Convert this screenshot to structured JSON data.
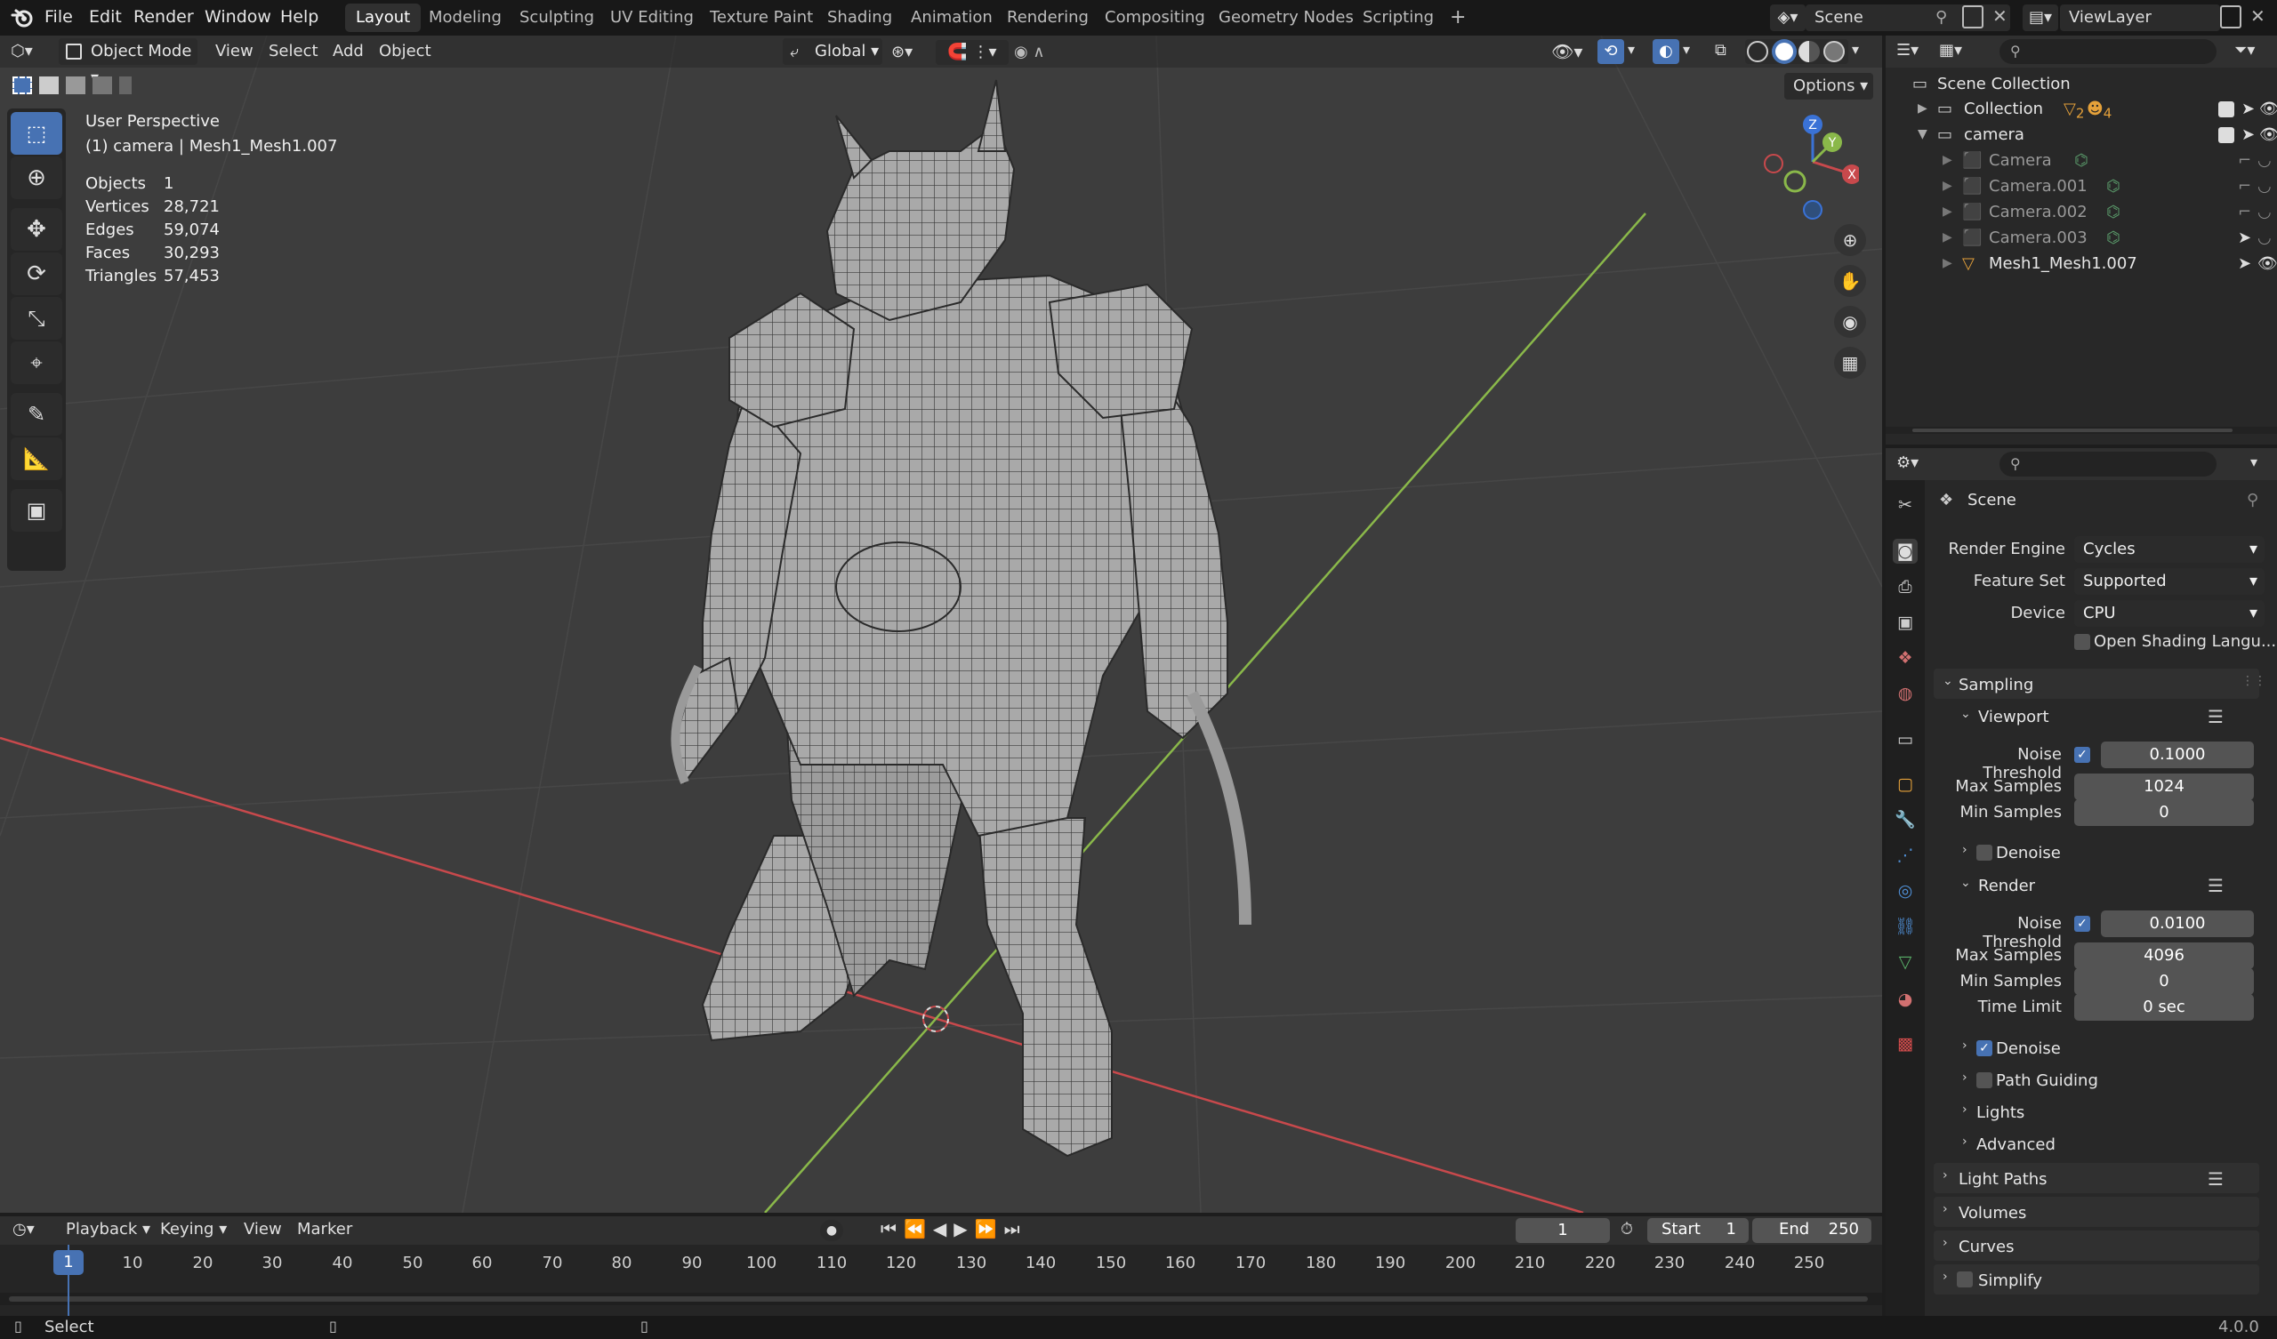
{
  "app": {
    "logo": "blender-logo-icon"
  },
  "menu": [
    "File",
    "Edit",
    "Render",
    "Window",
    "Help"
  ],
  "workspaces": [
    "Layout",
    "Modeling",
    "Sculpting",
    "UV Editing",
    "Texture Paint",
    "Shading",
    "Animation",
    "Rendering",
    "Compositing",
    "Geometry Nodes",
    "Scripting"
  ],
  "active_workspace": "Layout",
  "scene": {
    "name": "Scene",
    "view_layer": "ViewLayer"
  },
  "viewport": {
    "mode": "Object Mode",
    "menus": [
      "View",
      "Select",
      "Add",
      "Object"
    ],
    "transform_orientation": "Global",
    "options_label": "Options",
    "perspective": "User Perspective",
    "active_info": "(1) camera | Mesh1_Mesh1.007",
    "stats": [
      {
        "label": "Objects",
        "value": "1"
      },
      {
        "label": "Vertices",
        "value": "28,721"
      },
      {
        "label": "Edges",
        "value": "59,074"
      },
      {
        "label": "Faces",
        "value": "30,293"
      },
      {
        "label": "Triangles",
        "value": "57,453"
      }
    ],
    "gizmo": {
      "x": "X",
      "y": "Y",
      "z": "Z"
    },
    "colors": {
      "bg": "#3d3d3d",
      "x_axis": "#c8494c",
      "y_axis": "#8ab84a",
      "selection": "#4772b3"
    }
  },
  "outliner": {
    "root": "Scene Collection",
    "rows": [
      {
        "name": "Collection",
        "level": 1,
        "type": "collection",
        "badge1": "2",
        "badge2": "4"
      },
      {
        "name": "camera",
        "level": 1,
        "type": "collection",
        "expanded": true
      },
      {
        "name": "Camera",
        "level": 2,
        "type": "camera"
      },
      {
        "name": "Camera.001",
        "level": 2,
        "type": "camera"
      },
      {
        "name": "Camera.002",
        "level": 2,
        "type": "camera"
      },
      {
        "name": "Camera.003",
        "level": 2,
        "type": "camera"
      },
      {
        "name": "Mesh1_Mesh1.007",
        "level": 2,
        "type": "mesh"
      }
    ]
  },
  "properties": {
    "context": "Scene",
    "render_engine_label": "Render Engine",
    "render_engine": "Cycles",
    "feature_set_label": "Feature Set",
    "feature_set": "Supported",
    "device_label": "Device",
    "device": "CPU",
    "osl_label": "Open Shading Langu...",
    "sampling": {
      "title": "Sampling",
      "viewport": {
        "title": "Viewport",
        "noise_label": "Noise Threshold",
        "noise": "0.1000",
        "max_label": "Max Samples",
        "max": "1024",
        "min_label": "Min Samples",
        "min": "0",
        "denoise_label": "Denoise"
      },
      "render": {
        "title": "Render",
        "noise_label": "Noise Threshold",
        "noise": "0.0100",
        "max_label": "Max Samples",
        "max": "4096",
        "min_label": "Min Samples",
        "min": "0",
        "time_label": "Time Limit",
        "time": "0 sec",
        "denoise_label": "Denoise",
        "path_guiding_label": "Path Guiding",
        "lights_label": "Lights",
        "advanced_label": "Advanced"
      }
    },
    "panels": [
      "Light Paths",
      "Volumes",
      "Curves",
      "Simplify"
    ]
  },
  "timeline": {
    "menus": [
      "Playback",
      "Keying",
      "View",
      "Marker"
    ],
    "current_frame": "1",
    "start_label": "Start",
    "start": "1",
    "end_label": "End",
    "end": "250",
    "ticks": [
      "1",
      "10",
      "20",
      "30",
      "40",
      "50",
      "60",
      "70",
      "80",
      "90",
      "100",
      "110",
      "120",
      "130",
      "140",
      "150",
      "160",
      "170",
      "180",
      "190",
      "200",
      "210",
      "220",
      "230",
      "240",
      "250"
    ]
  },
  "statusbar": {
    "left": "Select",
    "version": "4.0.0"
  }
}
